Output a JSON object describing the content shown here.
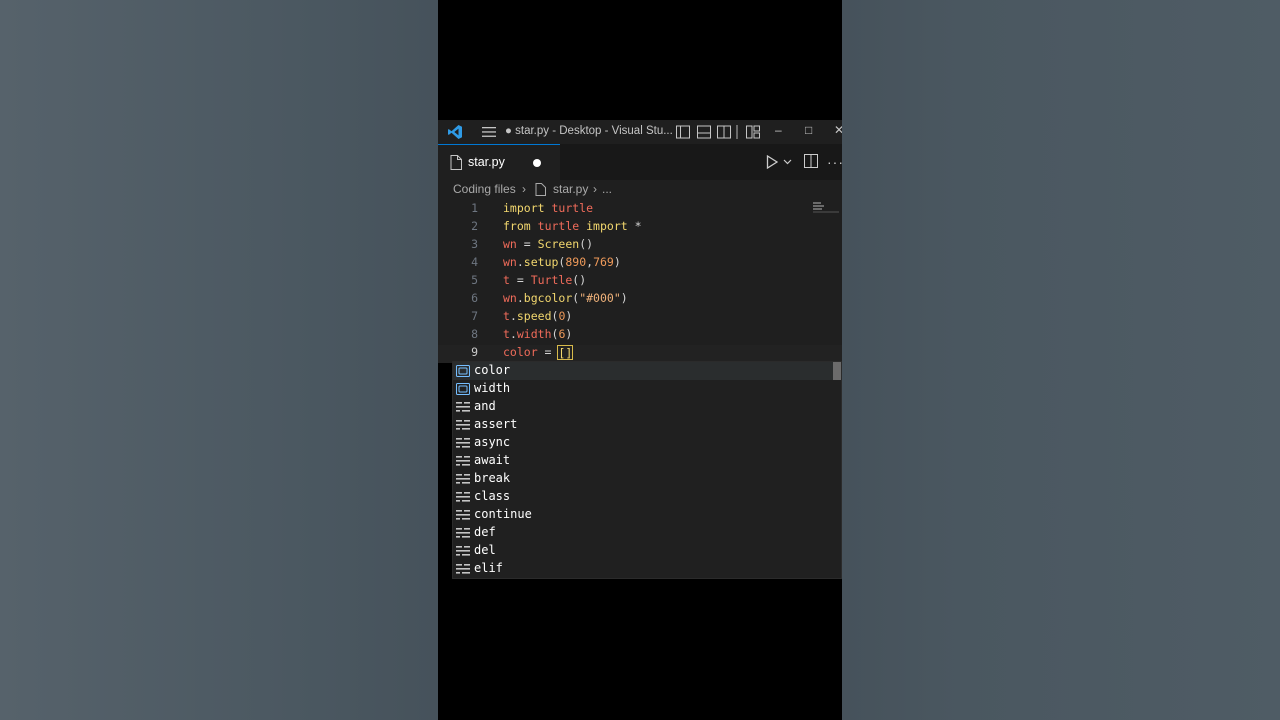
{
  "window": {
    "title": "● star.py - Desktop - Visual Stu...",
    "minimize": "–",
    "maximize": "□",
    "close": "✕"
  },
  "tab": {
    "label": "star.py"
  },
  "breadcrumb": {
    "folder": "Coding files",
    "file": "star.py",
    "more": "..."
  },
  "toolbar": {
    "more": "···"
  },
  "editor": {
    "lines": [
      {
        "n": "1",
        "tokens": [
          {
            "t": "import",
            "c": "kw"
          },
          {
            "t": " "
          },
          {
            "t": "turtle",
            "c": "mod"
          }
        ]
      },
      {
        "n": "2",
        "tokens": [
          {
            "t": "from",
            "c": "kw"
          },
          {
            "t": " "
          },
          {
            "t": "turtle",
            "c": "mod"
          },
          {
            "t": " "
          },
          {
            "t": "import",
            "c": "kw"
          },
          {
            "t": " *",
            "c": "op"
          }
        ]
      },
      {
        "n": "3",
        "tokens": [
          {
            "t": "wn",
            "c": "mod"
          },
          {
            "t": " = "
          },
          {
            "t": "Screen",
            "c": "fn"
          },
          {
            "t": "()"
          }
        ]
      },
      {
        "n": "4",
        "tokens": [
          {
            "t": "wn",
            "c": "mod"
          },
          {
            "t": "."
          },
          {
            "t": "setup",
            "c": "fn"
          },
          {
            "t": "("
          },
          {
            "t": "890",
            "c": "num"
          },
          {
            "t": ","
          },
          {
            "t": "769",
            "c": "num"
          },
          {
            "t": ")"
          }
        ]
      },
      {
        "n": "5",
        "tokens": [
          {
            "t": "t",
            "c": "mod"
          },
          {
            "t": " = "
          },
          {
            "t": "Turtle",
            "c": "mod"
          },
          {
            "t": "()"
          }
        ]
      },
      {
        "n": "6",
        "tokens": [
          {
            "t": "wn",
            "c": "mod"
          },
          {
            "t": "."
          },
          {
            "t": "bgcolor",
            "c": "fn"
          },
          {
            "t": "("
          },
          {
            "t": "\"#000\"",
            "c": "str"
          },
          {
            "t": ")"
          }
        ]
      },
      {
        "n": "7",
        "tokens": [
          {
            "t": "t",
            "c": "mod"
          },
          {
            "t": "."
          },
          {
            "t": "speed",
            "c": "fn"
          },
          {
            "t": "("
          },
          {
            "t": "0",
            "c": "num"
          },
          {
            "t": ")"
          }
        ]
      },
      {
        "n": "8",
        "tokens": [
          {
            "t": "t",
            "c": "mod"
          },
          {
            "t": "."
          },
          {
            "t": "width",
            "c": "mod"
          },
          {
            "t": "("
          },
          {
            "t": "6",
            "c": "num"
          },
          {
            "t": ")"
          }
        ]
      },
      {
        "n": "9",
        "tokens": [
          {
            "t": "color",
            "c": "mod"
          },
          {
            "t": " = "
          }
        ],
        "cursor": "[]",
        "current": true
      }
    ]
  },
  "suggestions": [
    {
      "label": "color",
      "kind": "variable-icon"
    },
    {
      "label": "width",
      "kind": "variable-icon"
    },
    {
      "label": "and",
      "kind": "keyword-icon"
    },
    {
      "label": "assert",
      "kind": "keyword-icon"
    },
    {
      "label": "async",
      "kind": "keyword-icon"
    },
    {
      "label": "await",
      "kind": "keyword-icon"
    },
    {
      "label": "break",
      "kind": "keyword-icon"
    },
    {
      "label": "class",
      "kind": "keyword-icon"
    },
    {
      "label": "continue",
      "kind": "keyword-icon"
    },
    {
      "label": "def",
      "kind": "keyword-icon"
    },
    {
      "label": "del",
      "kind": "keyword-icon"
    },
    {
      "label": "elif",
      "kind": "keyword-icon"
    }
  ],
  "colors": {
    "accent": "#0078d4",
    "editor_bg": "#1f1f1f",
    "keyword": "#f2d76e",
    "identifier": "#ef6b5a",
    "number": "#ef9a5a"
  }
}
